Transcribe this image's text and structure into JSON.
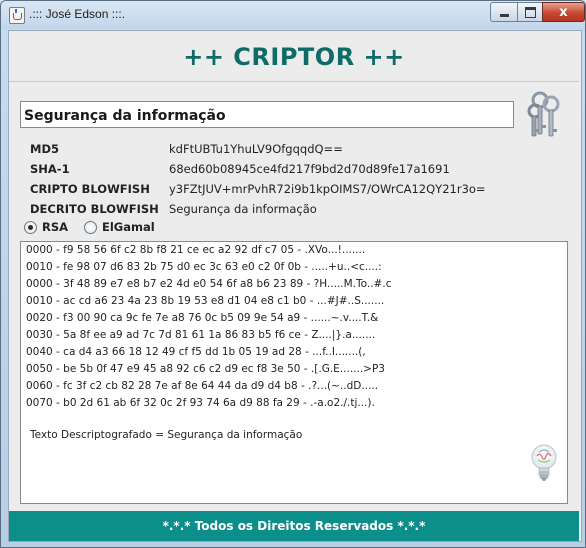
{
  "window": {
    "title": ".::: José Edson :::.",
    "minimize_label": "",
    "maximize_label": "",
    "close_label": "x"
  },
  "header": {
    "title": "++ CRIPTOR ++"
  },
  "input": {
    "value": "Segurança da informação"
  },
  "hashes": {
    "md5": {
      "label": "MD5",
      "value": "kdFtUBTu1YhuLV9OfgqqdQ=="
    },
    "sha1": {
      "label": "SHA-1",
      "value": "68ed60b08945ce4fd217f9bd2d70d89fe17a1691"
    },
    "cripto_blowfish": {
      "label": "CRIPTO BLOWFISH",
      "value": "y3FZtJUV+mrPvhR72i9b1kpOIMS7/OWrCA12QY21r3o="
    },
    "decrito_blowfish": {
      "label": "DECRITO BLOWFISH",
      "value": "Segurança da informação"
    }
  },
  "radio": {
    "rsa": {
      "label": "RSA",
      "selected": true
    },
    "elgamal": {
      "label": "ElGamal",
      "selected": false
    }
  },
  "output": {
    "lines": [
      "0000 - f9 58 56 6f c2 8b f8 21 ce ec a2 92 df c7 05  - .XVo...!.......",
      "0010 - fe 98 07 d6 83 2b 75 d0 ec 3c 63 e0 c2 0f 0b  - .....+u..<c....:",
      "0000 - 3f 48 89 e7 e8 b7 e2 4d e0 54 6f a8 b6 23 89  - ?H.....M.To..#.c",
      "0010 - ac cd a6 23 4a 23 8b 19 53 e8 d1 04 e8 c1 b0  - ...#J#..S.......",
      "0020 - f3 00 90 ca 9c fe 7e a8 76 0c b5 09 9e 54 a9  - ......~.v....T.&",
      "0030 - 5a 8f ee a9 ad 7c 7d 81 61 1a 86 83 b5 f6 ce  - Z....|}.a.......",
      "0040 - ca d4 a3 66 18 12 49 cf f5 dd 1b 05 19 ad 28  - ...f..I.......(,",
      "0050 - be 5b 0f 47 e9 45 a8 92 c6 c2 d9 ec f8 3e 50  - .[.G.E.......>P3",
      "0060 - fc 3f c2 cb 82 28 7e af 8e 64 44 da d9 d4 b8  - .?...(~..dD.....",
      "0070 - b0 2d 61 ab 6f 32 0c 2f 93 74 6a d9 88 fa 29  - .-a.o2./.tj...)."
    ],
    "decrypted_text": "Texto Descriptografado = Segurança da informação"
  },
  "icons": {
    "keys": "keys-icon",
    "bulb": "lightbulb-icon"
  },
  "footer": {
    "text": "*.*.*  Todos os Direitos Reservados  *.*.*"
  },
  "colors": {
    "accent": "#0f6b66",
    "footer_bg": "#0c8f8a"
  }
}
